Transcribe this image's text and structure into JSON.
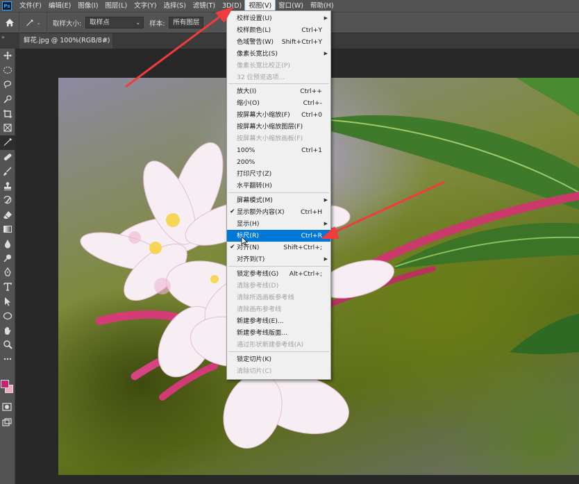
{
  "menubar": {
    "items": [
      {
        "label": "文件(F)"
      },
      {
        "label": "编辑(E)"
      },
      {
        "label": "图像(I)"
      },
      {
        "label": "图层(L)"
      },
      {
        "label": "文字(Y)"
      },
      {
        "label": "选择(S)"
      },
      {
        "label": "滤镜(T)"
      },
      {
        "label": "3D(D)"
      },
      {
        "label": "视图(V)"
      },
      {
        "label": "窗口(W)"
      },
      {
        "label": "帮助(H)"
      }
    ],
    "active_index": 8
  },
  "options_bar": {
    "sample_size_label": "取样大小:",
    "sample_size_value": "取样点",
    "sample_label": "样本:",
    "sample_value": "所有图层"
  },
  "document_tab": {
    "title": "鲜花.jpg @ 100%(RGB/8#)",
    "close": "×"
  },
  "view_menu": {
    "items": [
      {
        "label": "校样设置(U)",
        "shortcut": "",
        "submenu": true,
        "disabled": false
      },
      {
        "label": "校样颜色(L)",
        "shortcut": "Ctrl+Y",
        "submenu": false,
        "disabled": false
      },
      {
        "label": "色域警告(W)",
        "shortcut": "Shift+Ctrl+Y",
        "submenu": false,
        "disabled": false
      },
      {
        "label": "像素长宽比(S)",
        "shortcut": "",
        "submenu": true,
        "disabled": false
      },
      {
        "label": "像素长宽比校正(P)",
        "shortcut": "",
        "submenu": false,
        "disabled": true
      },
      {
        "label": "32 位预览选项...",
        "shortcut": "",
        "submenu": false,
        "disabled": true
      },
      {
        "label": "放大(I)",
        "shortcut": "Ctrl++",
        "submenu": false,
        "disabled": false
      },
      {
        "label": "缩小(O)",
        "shortcut": "Ctrl+-",
        "submenu": false,
        "disabled": false
      },
      {
        "label": "按屏幕大小缩放(F)",
        "shortcut": "Ctrl+0",
        "submenu": false,
        "disabled": false
      },
      {
        "label": "按屏幕大小缩放图层(F)",
        "shortcut": "",
        "submenu": false,
        "disabled": false
      },
      {
        "label": "按屏幕大小缩放画板(F)",
        "shortcut": "",
        "submenu": false,
        "disabled": true
      },
      {
        "label": "100%",
        "shortcut": "Ctrl+1",
        "submenu": false,
        "disabled": false
      },
      {
        "label": "200%",
        "shortcut": "",
        "submenu": false,
        "disabled": false
      },
      {
        "label": "打印尺寸(Z)",
        "shortcut": "",
        "submenu": false,
        "disabled": false
      },
      {
        "label": "水平翻转(H)",
        "shortcut": "",
        "submenu": false,
        "disabled": false
      },
      {
        "label": "屏幕模式(M)",
        "shortcut": "",
        "submenu": true,
        "disabled": false
      },
      {
        "label": "显示额外内容(X)",
        "shortcut": "Ctrl+H",
        "submenu": false,
        "disabled": false,
        "checked": true
      },
      {
        "label": "显示(H)",
        "shortcut": "",
        "submenu": true,
        "disabled": false
      },
      {
        "label": "标尺(R)",
        "shortcut": "Ctrl+R",
        "submenu": false,
        "disabled": false,
        "highlighted": true
      },
      {
        "label": "对齐(N)",
        "shortcut": "Shift+Ctrl+;",
        "submenu": false,
        "disabled": false,
        "checked": true
      },
      {
        "label": "对齐到(T)",
        "shortcut": "",
        "submenu": true,
        "disabled": false
      },
      {
        "label": "锁定参考线(G)",
        "shortcut": "Alt+Ctrl+;",
        "submenu": false,
        "disabled": false
      },
      {
        "label": "清除参考线(D)",
        "shortcut": "",
        "submenu": false,
        "disabled": true
      },
      {
        "label": "清除所选画板参考线",
        "shortcut": "",
        "submenu": false,
        "disabled": true
      },
      {
        "label": "清除画布参考线",
        "shortcut": "",
        "submenu": false,
        "disabled": true
      },
      {
        "label": "新建参考线(E)...",
        "shortcut": "",
        "submenu": false,
        "disabled": false
      },
      {
        "label": "新建参考线版面...",
        "shortcut": "",
        "submenu": false,
        "disabled": false
      },
      {
        "label": "通过形状新建参考线(A)",
        "shortcut": "",
        "submenu": false,
        "disabled": true
      },
      {
        "label": "锁定切片(K)",
        "shortcut": "",
        "submenu": false,
        "disabled": false
      },
      {
        "label": "清除切片(C)",
        "shortcut": "",
        "submenu": false,
        "disabled": true
      }
    ]
  },
  "colors": {
    "foreground": "#c0266e",
    "background": "#f2a8b6",
    "menu_highlight": "#0078d7",
    "annotation_arrow": "#f03c3c"
  },
  "toolbar": {
    "icons": [
      "move-icon",
      "marquee-icon",
      "lasso-icon",
      "quick-select-icon",
      "crop-icon",
      "frame-icon",
      "eyedropper-icon",
      "healing-icon",
      "brush-icon",
      "stamp-icon",
      "history-brush-icon",
      "eraser-icon",
      "gradient-icon",
      "blur-icon",
      "dodge-icon",
      "pen-icon",
      "type-icon",
      "path-select-icon",
      "shape-icon",
      "hand-icon",
      "zoom-icon",
      "more-tools-icon"
    ]
  }
}
